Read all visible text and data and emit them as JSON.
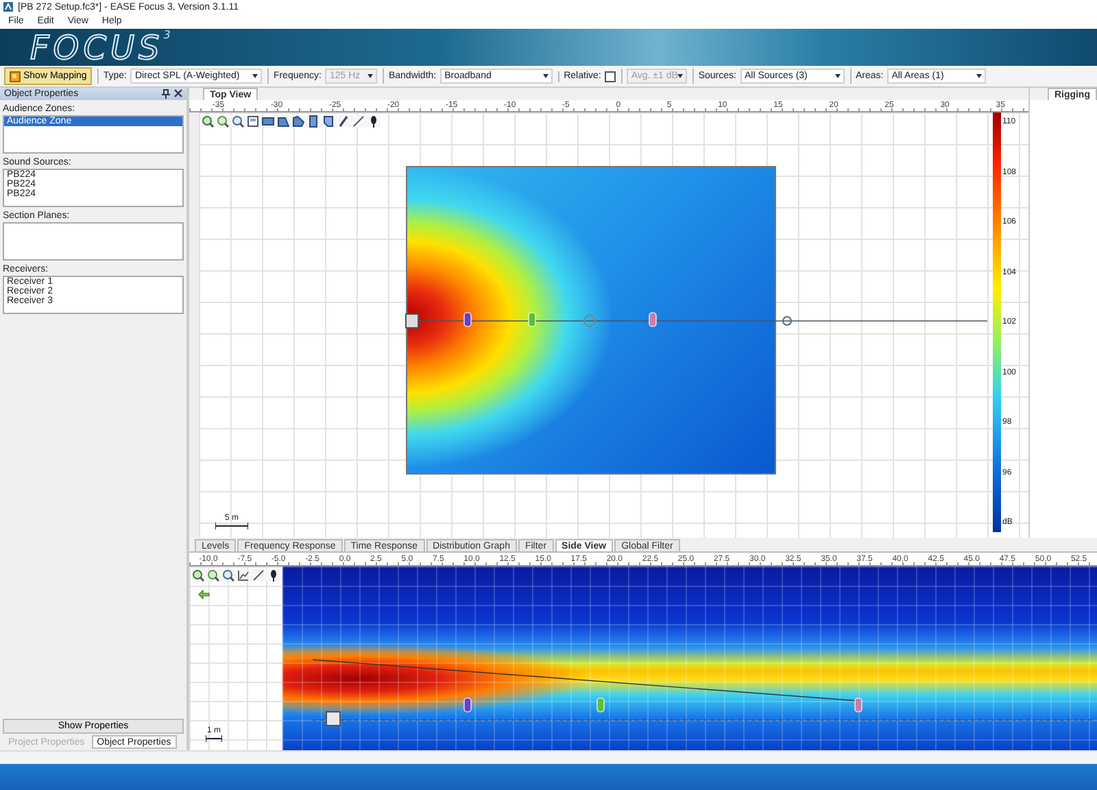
{
  "window": {
    "title": "[PB 272 Setup.fc3*] - EASE Focus 3, Version 3.1.11"
  },
  "menu": [
    "File",
    "Edit",
    "View",
    "Help"
  ],
  "logo": {
    "name": "FOCUS",
    "superscript": "3"
  },
  "toolbar": {
    "show_mapping": {
      "label": "Show Mapping",
      "on": true
    },
    "controls": [
      {
        "kind": "dropdown",
        "label": "Type:",
        "value": "Direct SPL (A-Weighted)",
        "disabled": false
      },
      {
        "kind": "dropdown",
        "label": "Frequency:",
        "value": "125 Hz",
        "disabled": true
      },
      {
        "kind": "dropdown",
        "label": "Bandwidth:",
        "value": "Broadband",
        "disabled": false
      },
      {
        "kind": "checkbox",
        "label": "Relative:",
        "checked": false
      },
      {
        "kind": "dropdown",
        "value": "Avg. ±1 dB",
        "disabled": true
      },
      {
        "kind": "dropdown",
        "label": "Sources:",
        "value": "All Sources (3)",
        "disabled": false
      },
      {
        "kind": "dropdown",
        "label": "Areas:",
        "value": "All Areas (1)",
        "disabled": false
      }
    ]
  },
  "object_properties": {
    "title": "Object Properties",
    "groups": [
      {
        "label": "Audience Zones:",
        "items": [
          {
            "label": "Audience Zone",
            "selected": true
          }
        ]
      },
      {
        "label": "Sound Sources:",
        "items": [
          {
            "label": "PB224",
            "selected": false
          },
          {
            "label": "PB224",
            "selected": false
          },
          {
            "label": "PB224",
            "selected": false
          }
        ]
      },
      {
        "label": "Section Planes:"
      },
      {
        "label": "Receivers:",
        "items": [
          {
            "label": "Receiver 1",
            "selected": false,
            "color": "#6a3fd0"
          },
          {
            "label": "Receiver 2",
            "selected": false,
            "color": "#5cc03a"
          },
          {
            "label": "Receiver 3",
            "selected": false,
            "color": "#d07aa8"
          }
        ]
      }
    ],
    "show_properties": "Show Properties",
    "tabs": [
      {
        "label": "Project Properties",
        "selected": false
      },
      {
        "label": "Object Properties",
        "selected": true
      }
    ]
  },
  "top_view": {
    "tab": {
      "label": "Top View",
      "selected": true
    },
    "ruler": [
      "-35",
      "-30",
      "-25",
      "-20",
      "-15",
      "-10",
      "-5",
      "0",
      "5",
      "10",
      "15",
      "20",
      "25",
      "30",
      "35"
    ],
    "scale_label": "5 m",
    "colorbar": {
      "ticks": [
        "110",
        "108",
        "106",
        "104",
        "102",
        "100",
        "98",
        "96"
      ],
      "unit": "dB"
    }
  },
  "rigging_tab": {
    "label": "Rigging",
    "selected": true
  },
  "view_tabs": [
    {
      "label": "Levels",
      "selected": false
    },
    {
      "label": "Frequency Response",
      "selected": false
    },
    {
      "label": "Time Response",
      "selected": false
    },
    {
      "label": "Distribution Graph",
      "selected": false
    },
    {
      "label": "Filter",
      "selected": false
    },
    {
      "label": "Side View",
      "selected": true
    },
    {
      "label": "Global Filter",
      "selected": false
    }
  ],
  "side_view": {
    "ruler": [
      "-10.0",
      "-7.5",
      "-5.0",
      "-2.5",
      "0.0",
      "2.5",
      "5.0",
      "7.5",
      "10.0",
      "12.5",
      "15.0",
      "17.5",
      "20.0",
      "22.5",
      "25.0",
      "27.5",
      "30.0",
      "32.5",
      "35.0",
      "37.5",
      "40.0",
      "42.5",
      "45.0",
      "47.5",
      "50.0",
      "52.5"
    ],
    "scale_label": "1 m"
  }
}
